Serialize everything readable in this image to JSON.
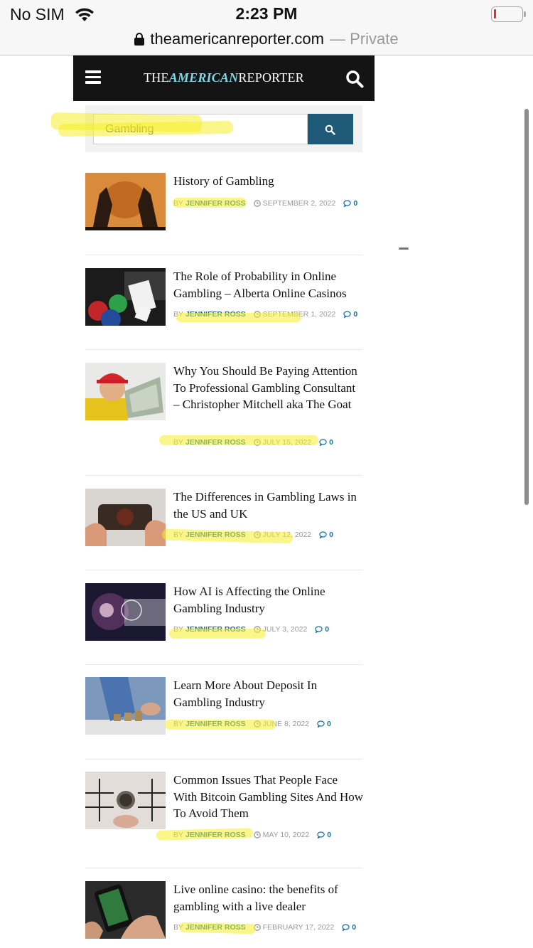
{
  "status_bar": {
    "carrier": "No SIM",
    "time": "2:23 PM"
  },
  "browser": {
    "domain": "theamericanreporter.com",
    "private_label": "— Private"
  },
  "site": {
    "logo_part1": "THE",
    "logo_accent": "AMERICAN",
    "logo_part2": "REPORTER"
  },
  "search": {
    "value": "Gambling"
  },
  "articles": [
    {
      "title": "History of Gambling",
      "by": "BY",
      "author": "JENNIFER ROSS",
      "date": "SEPTEMBER 2, 2022",
      "comments": "0"
    },
    {
      "title": "The Role of Probability in Online Gambling – Alberta Online Casinos",
      "by": "BY",
      "author": "JENNIFER ROSS",
      "date": "SEPTEMBER 1, 2022",
      "comments": "0"
    },
    {
      "title": "Why You Should Be Paying Attention To Professional Gambling Consultant – Christopher Mitchell aka The Goat",
      "by": "BY",
      "author": "JENNIFER ROSS",
      "date": "JULY 15, 2022",
      "comments": "0"
    },
    {
      "title": "The Differences in Gambling Laws in the US and UK",
      "by": "BY",
      "author": "JENNIFER ROSS",
      "date": "JULY 12, 2022",
      "comments": "0"
    },
    {
      "title": "How AI is Affecting the Online Gambling Industry",
      "by": "BY",
      "author": "JENNIFER ROSS",
      "date": "JULY 3, 2022",
      "comments": "0"
    },
    {
      "title": "Learn More About Deposit In Gambling Industry",
      "by": "BY",
      "author": "JENNIFER ROSS",
      "date": "JUNE 8, 2022",
      "comments": "0"
    },
    {
      "title": "Common Issues That People Face With Bitcoin Gambling Sites And How To Avoid Them",
      "by": "BY",
      "author": "JENNIFER ROSS",
      "date": "MAY 10, 2022",
      "comments": "0"
    },
    {
      "title": "Live online casino: the benefits of gambling with a live dealer",
      "by": "BY",
      "author": "JENNIFER ROSS",
      "date": "FEBRUARY 17, 2022",
      "comments": "0"
    }
  ],
  "colors": {
    "header_bg": "#141414",
    "logo_accent": "#7fd8e6",
    "search_button": "#1f5a78",
    "author_link": "#1a6fa0",
    "highlighter": "#f6ee28"
  }
}
